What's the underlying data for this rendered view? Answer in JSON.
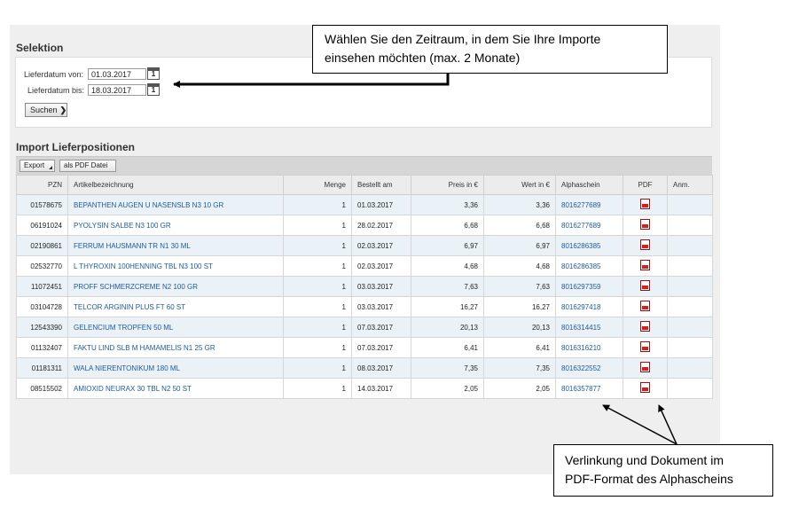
{
  "selection": {
    "title": "Selektion",
    "from_label": "Lieferdatum von:",
    "from_value": "01.03.2017",
    "to_label": "Lieferdatum bis:",
    "to_value": "18.03.2017",
    "calendar_day": "1",
    "search_label": "Suchen",
    "search_arrow": "❯"
  },
  "imports": {
    "title": "Import Lieferpositionen",
    "export_label": "Export",
    "pdf_export_label": "als PDF Datei"
  },
  "table": {
    "headers": {
      "pzn": "PZN",
      "article": "Artikelbezeichnung",
      "qty": "Menge",
      "ordered": "Bestellt am",
      "price": "Preis in €",
      "value": "Wert in €",
      "alpha": "Alphaschein",
      "pdf": "PDF",
      "note": "Anm."
    },
    "rows": [
      {
        "pzn": "01578675",
        "article": "BEPANTHEN AUGEN U NASENSLB N3 10 GR",
        "qty": "1",
        "ordered": "01.03.2017",
        "price": "3,36",
        "value": "3,36",
        "alpha": "8016277689",
        "note": ""
      },
      {
        "pzn": "06191024",
        "article": "PYOLYSIN SALBE N3 100 GR",
        "qty": "1",
        "ordered": "28.02.2017",
        "price": "6,68",
        "value": "6,68",
        "alpha": "8016277689",
        "note": ""
      },
      {
        "pzn": "02190861",
        "article": "FERRUM HAUSMANN TR N1 30 ML",
        "qty": "1",
        "ordered": "02.03.2017",
        "price": "6,97",
        "value": "6,97",
        "alpha": "8016286385",
        "note": ""
      },
      {
        "pzn": "02532770",
        "article": "L THYROXIN 100HENNING TBL N3 100 ST",
        "qty": "1",
        "ordered": "02.03.2017",
        "price": "4,68",
        "value": "4,68",
        "alpha": "8016286385",
        "note": ""
      },
      {
        "pzn": "11072451",
        "article": "PROFF SCHMERZCREME N2 100 GR",
        "qty": "1",
        "ordered": "03.03.2017",
        "price": "7,63",
        "value": "7,63",
        "alpha": "8016297359",
        "note": ""
      },
      {
        "pzn": "03104728",
        "article": "TELCOR ARGININ PLUS FT 60 ST",
        "qty": "1",
        "ordered": "03.03.2017",
        "price": "16,27",
        "value": "16,27",
        "alpha": "8016297418",
        "note": ""
      },
      {
        "pzn": "12543390",
        "article": "GELENCIUM TROPFEN 50 ML",
        "qty": "1",
        "ordered": "07.03.2017",
        "price": "20,13",
        "value": "20,13",
        "alpha": "8016314415",
        "note": ""
      },
      {
        "pzn": "01132407",
        "article": "FAKTU LIND SLB M HAMAMELIS N1 25 GR",
        "qty": "1",
        "ordered": "07.03.2017",
        "price": "6,41",
        "value": "6,41",
        "alpha": "8016316210",
        "note": ""
      },
      {
        "pzn": "01181311",
        "article": "WALA NIERENTONIKUM 180 ML",
        "qty": "1",
        "ordered": "08.03.2017",
        "price": "7,35",
        "value": "7,35",
        "alpha": "8016322552",
        "note": ""
      },
      {
        "pzn": "08515502",
        "article": "AMIOXID NEURAX 30 TBL N2 50 ST",
        "qty": "1",
        "ordered": "14.03.2017",
        "price": "2,05",
        "value": "2,05",
        "alpha": "8016357877",
        "note": ""
      }
    ]
  },
  "callouts": {
    "timeframe_line1": "Wählen Sie den Zeitraum, in dem Sie Ihre Importe",
    "timeframe_line2": "einsehen möchten (max. 2 Monate)",
    "pdf_line1": "Verlinkung und Dokument im",
    "pdf_line2": "PDF-Format des Alphascheins"
  },
  "icons": {
    "calendar": "calendar-icon",
    "pdf": "pdf-file-icon",
    "dropdown": "dropdown-corner-icon"
  }
}
